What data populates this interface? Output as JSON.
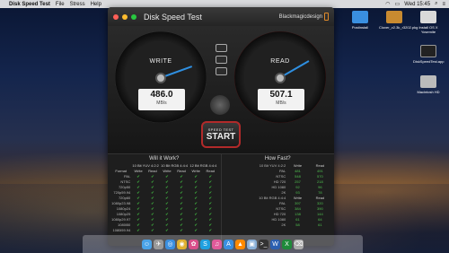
{
  "menubar": {
    "apple": "",
    "app": "Disk Speed Test",
    "items": [
      "File",
      "Stress",
      "Help"
    ],
    "clock": "Wed 15:45"
  },
  "window": {
    "title": "Disk Speed Test",
    "brand": "Blackmagicdesign"
  },
  "gauges": {
    "write": {
      "label": "WRITE",
      "value": "486.0",
      "unit": "MB/s"
    },
    "read": {
      "label": "READ",
      "value": "507.1",
      "unit": "MB/s"
    }
  },
  "start_button": {
    "top": "SPEED TEST",
    "label": "START"
  },
  "will_it_work": {
    "title": "Will it Work?",
    "groups": [
      "10 Bit YUV 4:2:2",
      "10 Bit RGB 4:4:4",
      "12 Bit RGB 4:4:4"
    ],
    "sub_headers": [
      "Format",
      "Write",
      "Read",
      "Write",
      "Read",
      "Write",
      "Read"
    ],
    "formats": [
      "PAL",
      "NTSC",
      "720p50",
      "720p59.94",
      "720p60",
      "1080p23.98",
      "1080p24",
      "1080p25",
      "1080p29.97",
      "1080i50",
      "1080i59.94"
    ]
  },
  "how_fast": {
    "title": "How Fast?",
    "section1": "10 Bit YUV 4:2:2",
    "section2": "10 Bit RGB 4:4:4",
    "headers": [
      "Write",
      "Read"
    ],
    "rows1": [
      [
        "PAL",
        "481",
        "491"
      ],
      [
        "NTSC",
        "548",
        "570"
      ],
      [
        "HD 720",
        "257",
        "218"
      ],
      [
        "HD 1080",
        "92",
        "96"
      ],
      [
        "2K",
        "93",
        "78"
      ]
    ],
    "rows2": [
      [
        "PAL",
        "397",
        "320"
      ],
      [
        "NTSC",
        "384",
        "390"
      ],
      [
        "HD 720",
        "138",
        "144"
      ],
      [
        "HD 1080",
        "61",
        "64"
      ],
      [
        "2K",
        "58",
        "61"
      ]
    ]
  },
  "desktop_icons": [
    "Postinstall",
    "Install OS X Yosemite",
    "Clover_v2.3k_r3202.pkg",
    "DiskSpeedTest.app",
    "Macintosh HD"
  ],
  "dock_icons": [
    "finder-icon",
    "launchpad-icon",
    "safari-icon",
    "chrome-icon",
    "photos-icon",
    "skype-icon",
    "itunes-icon",
    "appstore-icon",
    "vlc-icon",
    "preview-icon",
    "terminal-icon",
    "word-icon",
    "excel-icon",
    "trash-icon"
  ]
}
